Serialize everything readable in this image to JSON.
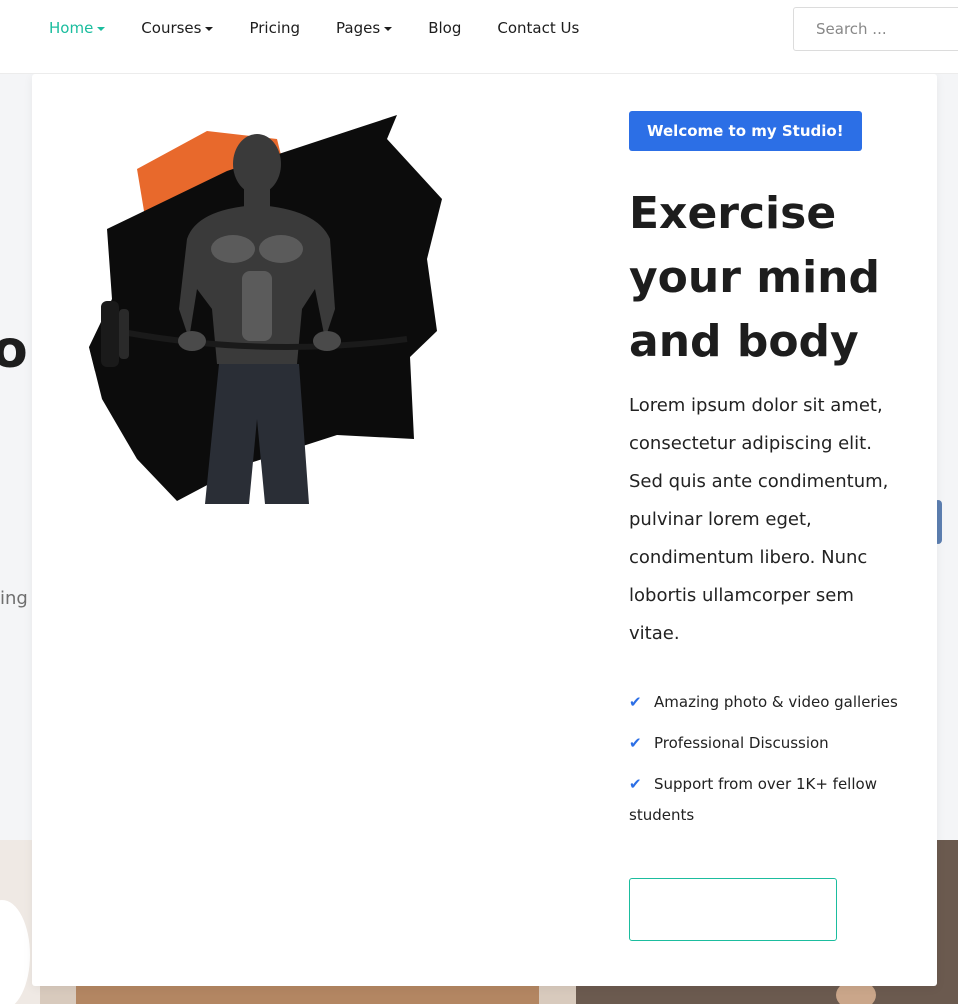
{
  "nav": {
    "items": [
      {
        "label": "Home",
        "has_caret": true,
        "active": true
      },
      {
        "label": "Courses",
        "has_caret": true,
        "active": false
      },
      {
        "label": "Pricing",
        "has_caret": false,
        "active": false
      },
      {
        "label": "Pages",
        "has_caret": true,
        "active": false
      },
      {
        "label": "Blog",
        "has_caret": false,
        "active": false
      },
      {
        "label": "Contact Us",
        "has_caret": false,
        "active": false
      }
    ],
    "search_placeholder": "Search ..."
  },
  "background": {
    "partial_heading": "ol",
    "partial_text": "ing"
  },
  "modal": {
    "badge": "Welcome to my Studio!",
    "headline": "Exercise your mind and body",
    "body": "Lorem ipsum dolor sit amet, consectetur adipiscing elit. Sed quis ante condimentum, pulvinar lorem eget, condimentum libero. Nunc lobortis ullamcorper sem vitae.",
    "features": [
      "Amazing photo & video galleries",
      "Professional Discussion",
      "Support from over 1K+ fellow students"
    ],
    "check_icon": "check-icon",
    "cta_label": ""
  },
  "colors": {
    "accent_teal": "#1bbd9e",
    "badge_blue": "#2c6fe6",
    "brush_orange": "#e8692c"
  }
}
